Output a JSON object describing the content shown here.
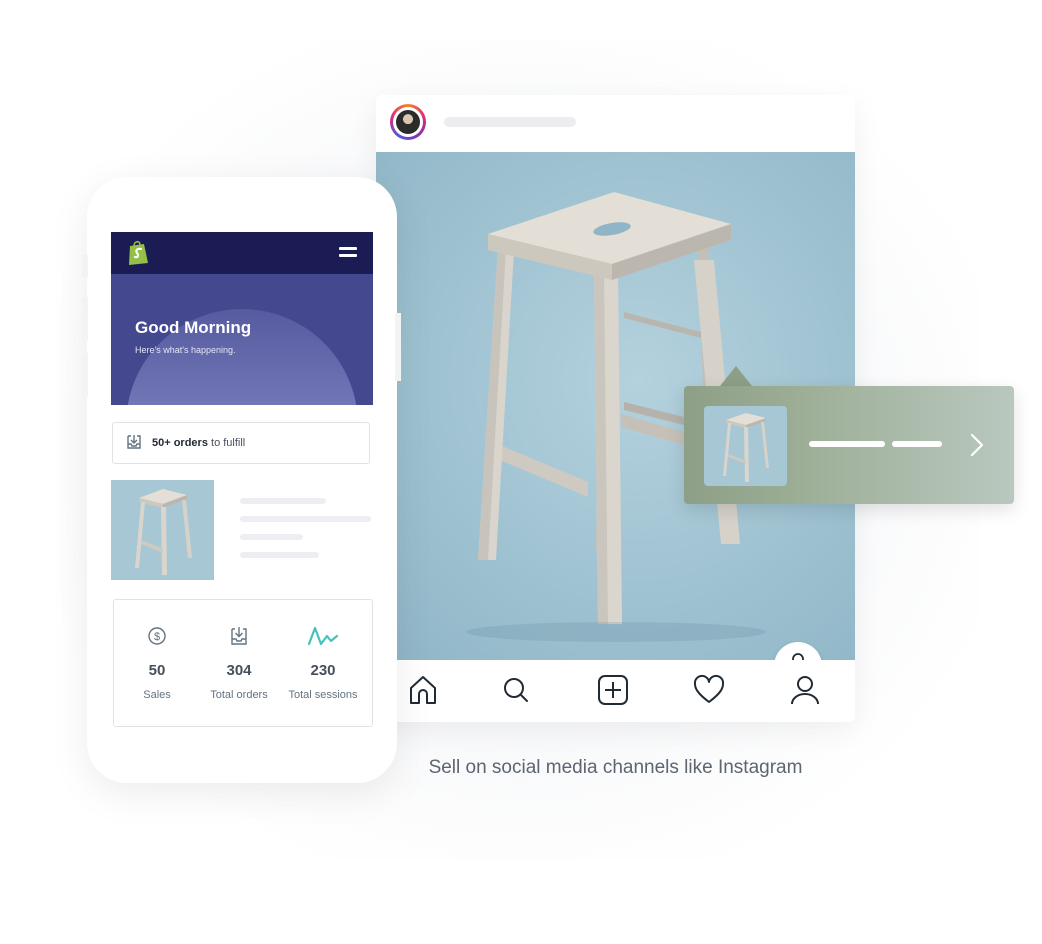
{
  "phone": {
    "greeting": "Good Morning",
    "greeting_sub": "Here's what's happening.",
    "orders_bold": "50+ orders",
    "orders_rest": " to fulfill",
    "stats": [
      {
        "icon": "dollar-circle-icon",
        "value": "50",
        "label": "Sales"
      },
      {
        "icon": "inbox-download-icon",
        "value": "304",
        "label": "Total orders"
      },
      {
        "icon": "sparkline-icon",
        "value": "230",
        "label": "Total sessions"
      }
    ]
  },
  "instagram": {
    "nav_icons": [
      "home-icon",
      "search-icon",
      "add-post-icon",
      "heart-icon",
      "profile-icon"
    ]
  },
  "caption": "Sell on social media channels like Instagram",
  "colors": {
    "app_bar": "#1c1c54",
    "hero": "#43488f",
    "accent_teal": "#47c1bf",
    "shopify_green": "#95bf47",
    "photo_bg": "#9fc2d1"
  }
}
